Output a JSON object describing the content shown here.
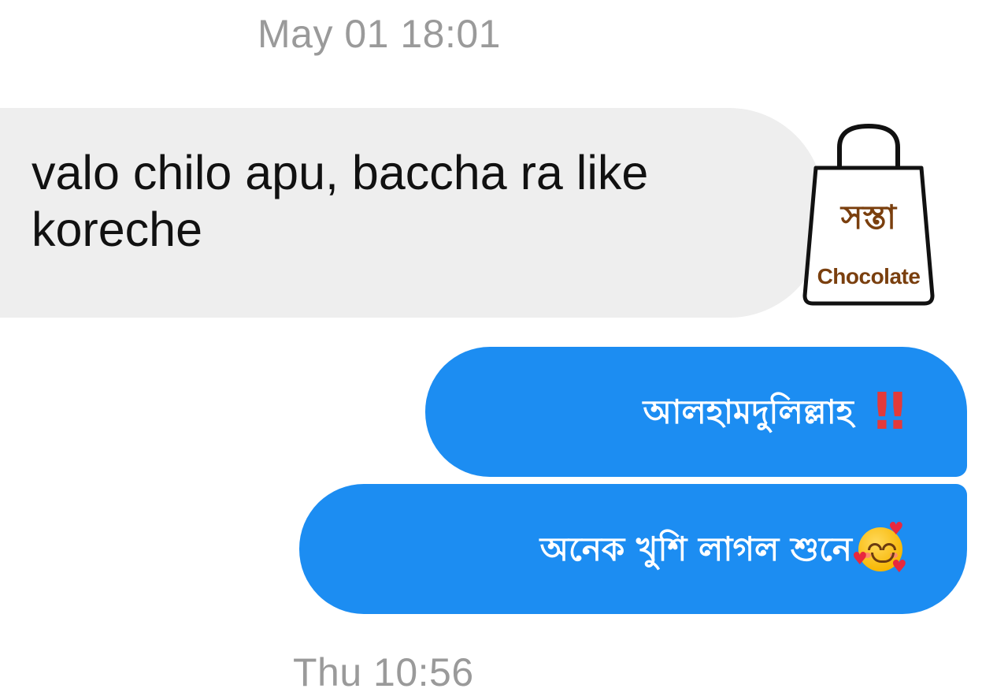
{
  "conversation": {
    "timestamp_top": "May 01 18:01",
    "timestamp_bottom": "Thu 10:56",
    "messages": [
      {
        "direction": "incoming",
        "text": "valo chilo apu, baccha ra like koreche"
      },
      {
        "direction": "outgoing",
        "text": "আলহামদুলিল্লাহ",
        "trailing_emoji": "double-exclamation-icon"
      },
      {
        "direction": "outgoing",
        "text": "অনেক খুশি লাগল শুনে",
        "trailing_emoji": "smiling-face-with-hearts-icon"
      }
    ]
  },
  "logo": {
    "text_bn": "সস্তা",
    "text_en": "Chocolate",
    "icon": "shopping-bag-icon",
    "color": "#7a3f0e"
  },
  "colors": {
    "incoming_bubble": "#eeeeee",
    "outgoing_bubble": "#1c8df2",
    "timestamp": "#9a9a9a"
  }
}
